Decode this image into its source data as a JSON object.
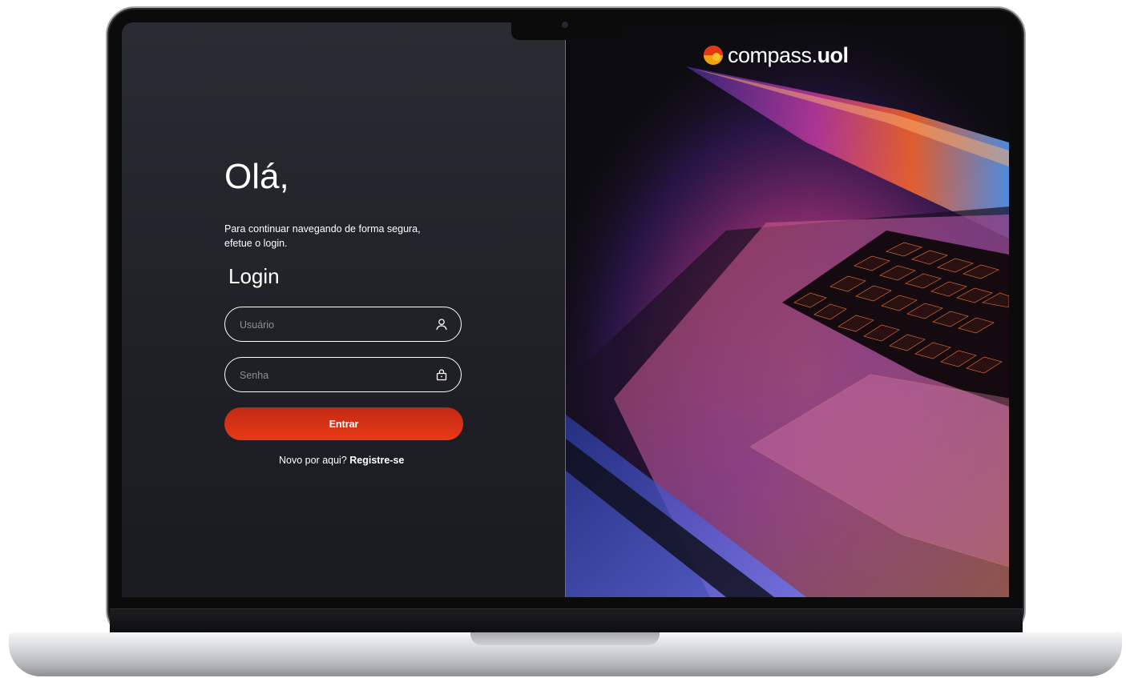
{
  "login": {
    "greeting": "Olá,",
    "subtitle": "Para continuar navegando de forma segura, efetue o login.",
    "title": "Login",
    "username_placeholder": "Usuário",
    "username_value": "",
    "password_placeholder": "Senha",
    "password_value": "",
    "submit_label": "Entrar",
    "register_prompt": "Novo por aqui?",
    "register_link": "Registre-se"
  },
  "brand": {
    "name": "compass",
    "suffix": "uol"
  },
  "colors": {
    "accent": "#e33816",
    "panel": "#1f2127",
    "text": "#ffffff"
  },
  "icons": {
    "username": "user-icon",
    "password": "lock-icon"
  }
}
